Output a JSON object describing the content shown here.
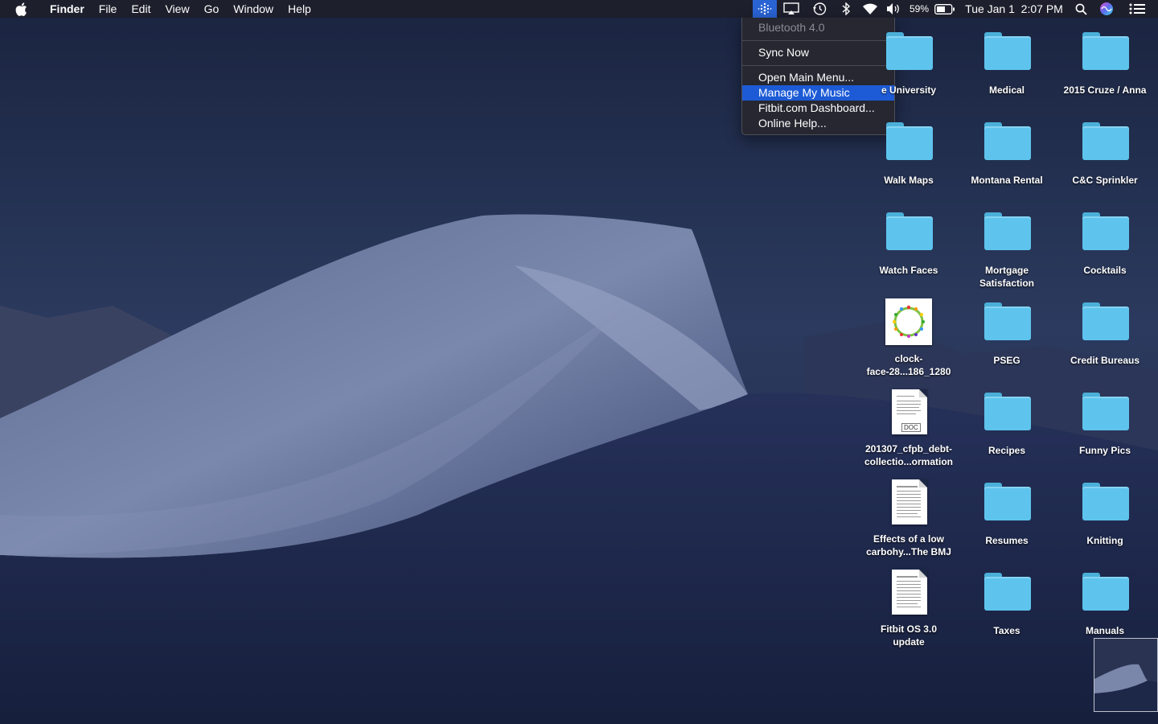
{
  "menubar": {
    "apple_icon": "apple-icon",
    "app_name": "Finder",
    "menus": [
      "File",
      "Edit",
      "View",
      "Go",
      "Window",
      "Help"
    ],
    "status": {
      "fitbit_icon": "fitbit-icon",
      "airplay_icon": "airplay-icon",
      "time_machine_icon": "time-machine-icon",
      "bluetooth_icon": "bluetooth-icon",
      "wifi_icon": "wifi-icon",
      "volume_icon": "volume-icon",
      "battery_percent": "59%",
      "battery_icon": "battery-icon",
      "clock": "Tue Jan 1  2:07 PM",
      "spotlight_icon": "search-icon",
      "siri_icon": "siri-icon",
      "notification_icon": "notification-center-icon"
    }
  },
  "fitbit_menu": {
    "header": "Bluetooth 4.0",
    "sync": "Sync Now",
    "items": [
      "Open Main Menu...",
      "Manage My Music",
      "Fitbit.com Dashboard...",
      "Online Help..."
    ],
    "selected_index": 1
  },
  "desktop": {
    "col1": [
      {
        "label": "e University",
        "type": "folder"
      },
      {
        "label": "Walk Maps",
        "type": "folder"
      },
      {
        "label": "Watch Faces",
        "type": "folder"
      },
      {
        "label": "clock-\nface-28...186_1280",
        "type": "image"
      },
      {
        "label": "201307_cfpb_debt-\ncollectio...ormation",
        "type": "doc",
        "badge": "DOC"
      },
      {
        "label": "Effects of a low\ncarbohy...The BMJ",
        "type": "pdf"
      },
      {
        "label": "Fitbit OS 3.0\nupdate",
        "type": "pdf"
      }
    ],
    "col2": [
      {
        "label": "Medical",
        "type": "folder"
      },
      {
        "label": "Montana Rental",
        "type": "folder"
      },
      {
        "label": "Mortgage\nSatisfaction",
        "type": "folder"
      },
      {
        "label": "PSEG",
        "type": "folder"
      },
      {
        "label": "Recipes",
        "type": "folder"
      },
      {
        "label": "Resumes",
        "type": "folder"
      },
      {
        "label": "Taxes",
        "type": "folder"
      }
    ],
    "col3": [
      {
        "label": "2015 Cruze  / Anna",
        "type": "folder"
      },
      {
        "label": "C&C Sprinkler",
        "type": "folder"
      },
      {
        "label": "Cocktails",
        "type": "folder"
      },
      {
        "label": "Credit Bureaus",
        "type": "folder"
      },
      {
        "label": "Funny Pics",
        "type": "folder"
      },
      {
        "label": "Knitting",
        "type": "folder"
      },
      {
        "label": "Manuals",
        "type": "folder"
      }
    ]
  },
  "screenshot_thumbnail": "screenshot-thumbnail",
  "colors": {
    "folder": "#5ec4ee",
    "highlight": "#1d5bd6",
    "menubar": "#1e2028"
  }
}
